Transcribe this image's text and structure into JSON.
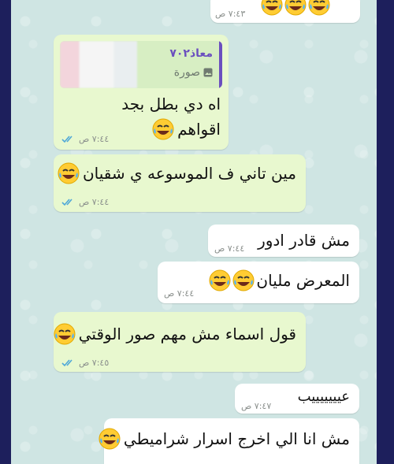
{
  "messages": [
    {
      "id": "m0",
      "text": "",
      "time": "٧:٤٣ ص",
      "direction": "incoming",
      "emoji_count": 3
    },
    {
      "id": "m1",
      "text_line1": "اه دي بطل بجد",
      "text_line2": "اقواهم",
      "time": "٧:٤٤ ص",
      "direction": "outgoing",
      "status": "read",
      "reply": {
        "author": "معاذ٧٠٢",
        "type": "صورة",
        "type_icon": "photo-icon"
      }
    },
    {
      "id": "m2",
      "text": "مين تاني ف الموسوعه ي شقيان",
      "time": "٧:٤٤ ص",
      "direction": "outgoing",
      "status": "read"
    },
    {
      "id": "m3",
      "text": "مش قادر ادور",
      "time": "٧:٤٤ ص",
      "direction": "incoming"
    },
    {
      "id": "m4",
      "text": "المعرض مليان",
      "time": "٧:٤٤ ص",
      "direction": "incoming"
    },
    {
      "id": "m5",
      "text": "قول اسماء مش مهم صور الوقتي",
      "time": "٧:٤٥ ص",
      "direction": "outgoing",
      "status": "read"
    },
    {
      "id": "m6",
      "text": "عيييييييب",
      "time": "٧:٤٧ ص",
      "direction": "incoming"
    },
    {
      "id": "m7",
      "text": "مش انا الي اخرج اسرار شراميطي",
      "time": "",
      "direction": "incoming"
    }
  ],
  "colors": {
    "outgoing_bubble": "#e8f8cf",
    "incoming_bubble": "#ffffff",
    "read_ticks": "#4fa8d8",
    "reply_accent": "#6b4fbf",
    "chat_bg": "#cfe5e3"
  },
  "icons": {
    "laugh": "face-with-tears-of-joy",
    "read": "double-check-icon"
  }
}
